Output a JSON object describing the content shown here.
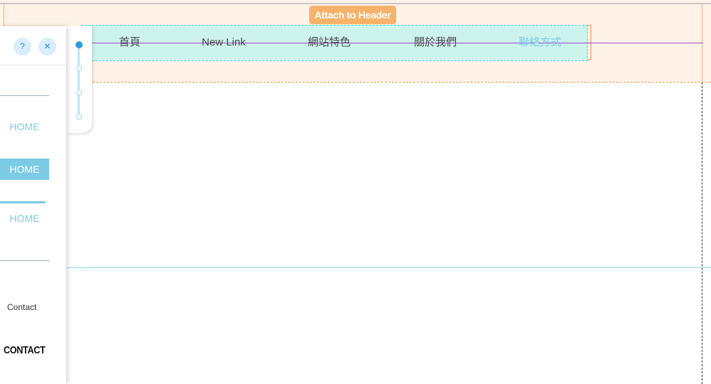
{
  "header": {
    "attach_label": "Attach to Header"
  },
  "menu": {
    "items": [
      {
        "label": "首頁"
      },
      {
        "label": "New Link"
      },
      {
        "label": "網站特色"
      },
      {
        "label": "關於我們"
      },
      {
        "label": "聯絡方式"
      }
    ]
  },
  "panel": {
    "help_label": "?",
    "close_label": "✕",
    "style_home_1": "HOME",
    "style_home_2": "HOME",
    "style_home_3": "HOME",
    "contact_plain": "Contact",
    "contact_bold": "CONTACT"
  },
  "colors": {
    "accent": "#7ccbe5",
    "attach_button": "#f7b26a",
    "menu_fill": "#cdf3ed"
  },
  "icons": {
    "help": "question-icon",
    "close": "close-icon"
  }
}
